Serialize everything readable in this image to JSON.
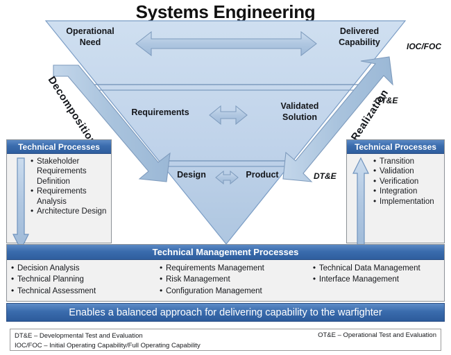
{
  "title": "Systems Engineering",
  "v_diagram": {
    "top_left_label": "Operational\nNeed",
    "top_right_label": "Delivered\nCapability",
    "mid_left_label": "Requirements",
    "mid_right_label": "Validated\nSolution",
    "bottom_left_label": "Design",
    "bottom_right_label": "Product",
    "left_band_label": "Decomposition",
    "right_band_label": "Realization",
    "acronym_top_right": "IOC/FOC",
    "acronym_mid_right": "OT&E",
    "acronym_bottom_right": "DT&E",
    "colors": {
      "v_fill": "#c3d6ec",
      "v_stroke": "#7a9cc4",
      "arrow_fill": "#b3c9e2",
      "arrow_stroke": "#7e9bbd",
      "band_fill": "#aac4de",
      "band_stroke": "#7e9bbd",
      "header_blue": "#3a6cad",
      "banner_blue": "#3a6cad"
    }
  },
  "technical_processes_left": {
    "header": "Technical Processes",
    "items": [
      "Stakeholder Requirements Definition",
      "Requirements Analysis",
      "Architecture Design"
    ],
    "arrow_direction": "down"
  },
  "technical_processes_right": {
    "header": "Technical Processes",
    "items": [
      "Transition",
      "Validation",
      "Verification",
      "Integration",
      "Implementation"
    ],
    "arrow_direction": "up"
  },
  "technical_management_processes": {
    "header": "Technical Management Processes",
    "columns": [
      [
        "Decision Analysis",
        "Technical Planning",
        "Technical Assessment"
      ],
      [
        "Requirements Management",
        "Risk Management",
        "Configuration Management"
      ],
      [
        "Technical Data Management",
        "Interface Management"
      ]
    ]
  },
  "banner": {
    "text": "Enables a balanced approach for delivering capability to the warfighter"
  },
  "legend": {
    "line1": "DT&E – Developmental Test and Evaluation",
    "line2": "IOC/FOC – Initial Operating Capability/Full Operating Capability",
    "right": "OT&E – Operational Test and Evaluation"
  }
}
